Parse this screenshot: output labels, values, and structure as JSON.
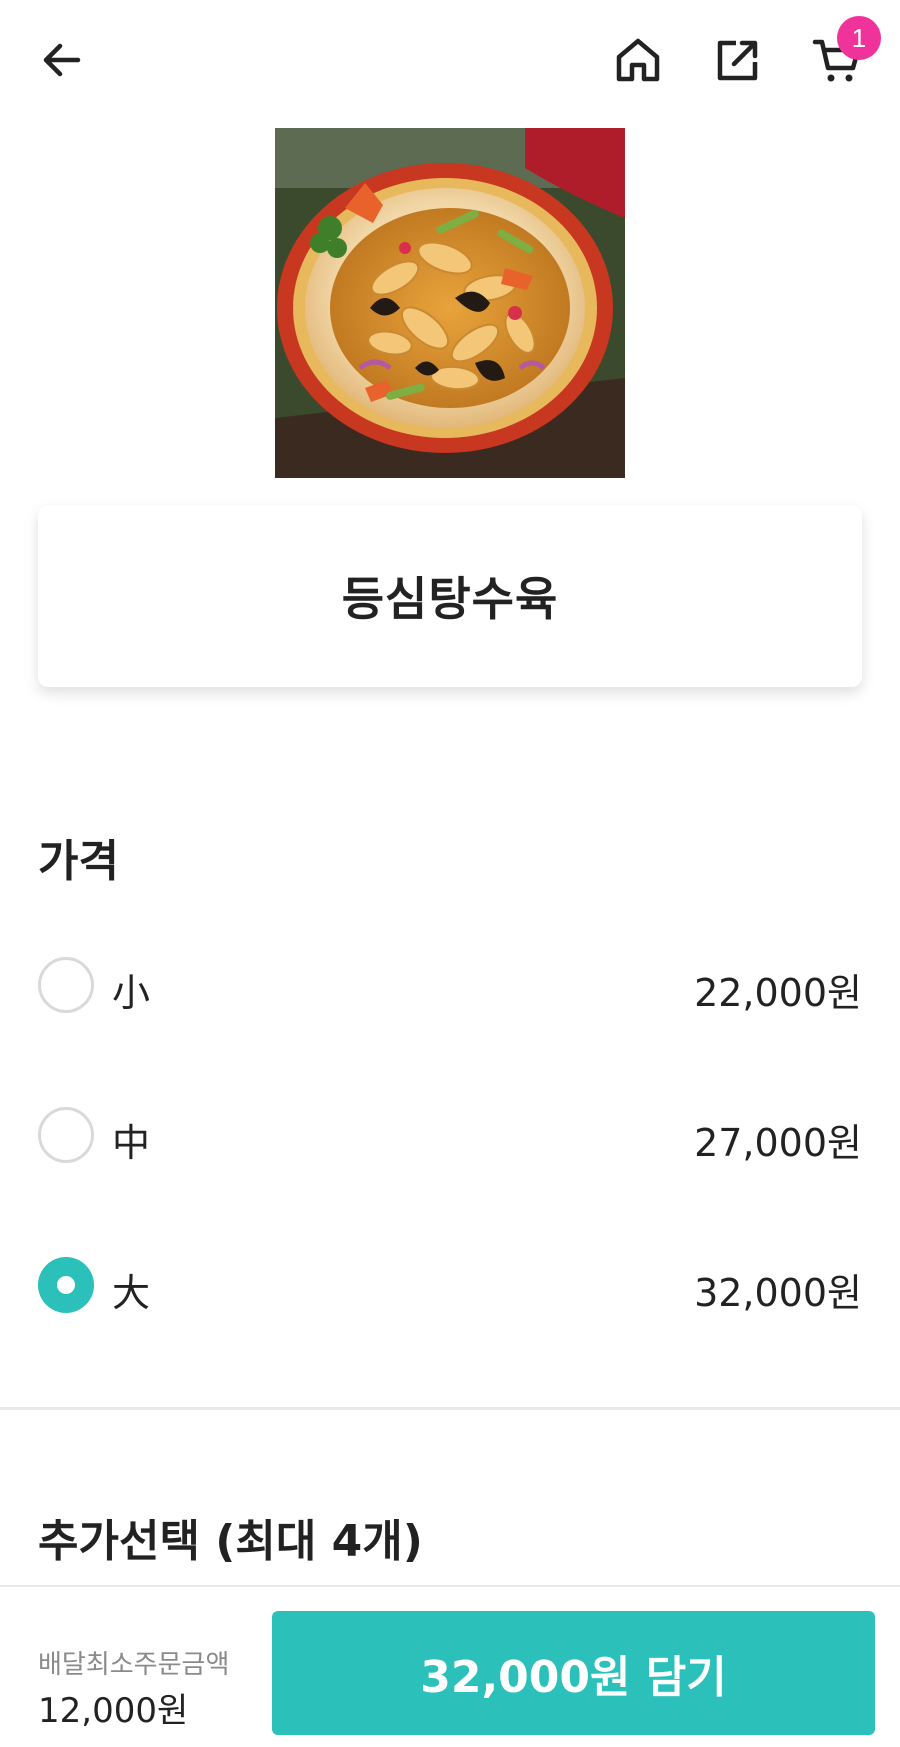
{
  "header": {
    "back_icon": "arrow-left-icon",
    "home_icon": "home-icon",
    "share_icon": "share-icon",
    "cart_icon": "cart-icon",
    "cart_count": "1",
    "badge_color": "#f0339b"
  },
  "product": {
    "image_alt": "food-photo",
    "name": "등심탕수육"
  },
  "price_section": {
    "title": "가격",
    "options": [
      {
        "label": "小",
        "price": "22,000원",
        "selected": false
      },
      {
        "label": "中",
        "price": "27,000원",
        "selected": false
      },
      {
        "label": "大",
        "price": "32,000원",
        "selected": true
      }
    ]
  },
  "extra_section": {
    "title": "추가선택 (최대 4개)"
  },
  "footer": {
    "min_order_label": "배달최소주문금액",
    "min_order_value": "12,000원",
    "add_button_label": "32,000원 담기",
    "accent_color": "#2bc1ba"
  }
}
